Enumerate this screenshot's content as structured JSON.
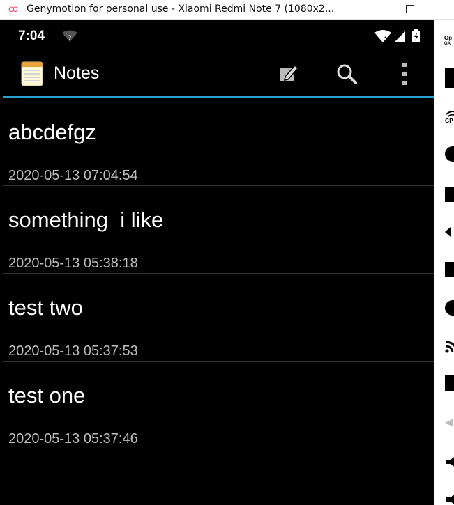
{
  "window": {
    "app_icon": "oo",
    "title": "Genymotion for personal use - Xiaomi Redmi Note 7 (1080x2..."
  },
  "statusbar": {
    "time": "7:04"
  },
  "actionbar": {
    "title": "Notes"
  },
  "notes": [
    {
      "title": "abcdefgz",
      "date": "2020-05-13 07:04:54"
    },
    {
      "title": "something  i like",
      "date": "2020-05-13 05:38:18"
    },
    {
      "title": "test two",
      "date": "2020-05-13 05:37:53"
    },
    {
      "title": "test one",
      "date": "2020-05-13 05:37:46"
    }
  ],
  "sidebar": {
    "label_top": "Op",
    "label_top2": "GA",
    "gps_label": "GP"
  },
  "colors": {
    "accent": "#2c9fd1",
    "background": "#000000"
  }
}
